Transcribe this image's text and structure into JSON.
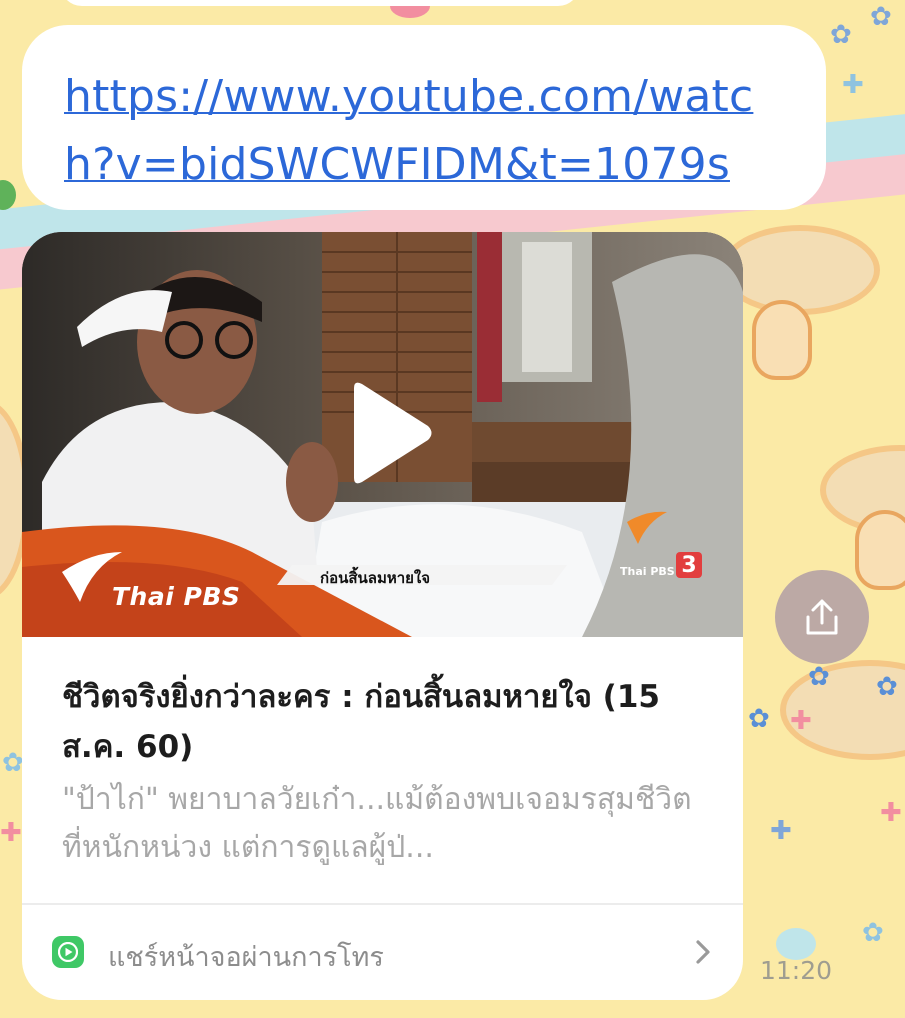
{
  "message": {
    "link_url": "https://www.youtube.com/watch?v=bidSWCWFIDM&t=1079s"
  },
  "preview_card": {
    "title": "ชีวิตจริงยิ่งกว่าละคร : ก่อนสิ้นลมหายใจ (15 ส.ค. 60)",
    "description": "\"ป้าไก่\" พยาบาลวัยเก๋า...แม้ต้องพบเจอมรสุมชีวิตที่หนักหน่วง แต่การดูแลผู้ป่...",
    "thumbnail": {
      "brand": "Thai PBS",
      "caption": "ก่อนสิ้นลมหายใจ",
      "channel_logo": "Thai PBS",
      "channel_number": "3"
    },
    "share_action_label": "แชร์หน้าจอผ่านการโทร"
  },
  "timestamp": "11:20",
  "icons": {
    "play": "play-icon",
    "share_screen": "screen-share-icon",
    "chevron": "chevron-right-icon",
    "forward": "share-icon"
  },
  "colors": {
    "link": "#2c68d8",
    "share_green": "#3fc866",
    "wallpaper": "#fbeaa6"
  }
}
